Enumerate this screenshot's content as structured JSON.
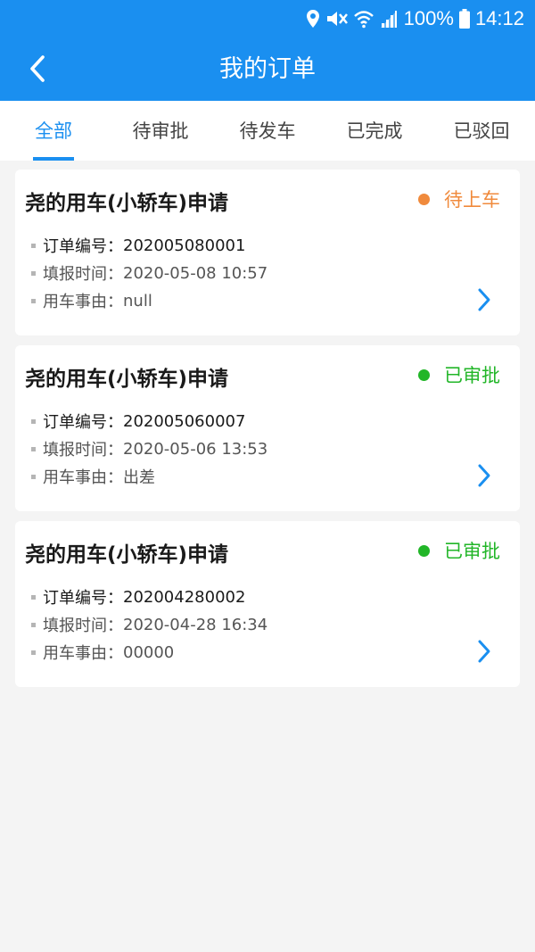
{
  "status_bar": {
    "battery": "100%",
    "time": "14:12"
  },
  "nav": {
    "title": "我的订单",
    "back_icon": "chevron-left-icon"
  },
  "tabs": [
    {
      "label": "全部",
      "active": true
    },
    {
      "label": "待审批",
      "active": false
    },
    {
      "label": "待发车",
      "active": false
    },
    {
      "label": "已完成",
      "active": false
    },
    {
      "label": "已驳回",
      "active": false
    }
  ],
  "colors": {
    "brand": "#1a8ff0",
    "status_waiting": "#f08a3c",
    "status_approved": "#22b628"
  },
  "orders": [
    {
      "title": "尧的用车(小轿车)申请",
      "status": "待上车",
      "status_color": "#f08a3c",
      "order_no_label": "订单编号：",
      "order_no": "202005080001",
      "time_label": "填报时间：",
      "time": "2020-05-08 10:57",
      "reason_label": "用车事由：",
      "reason": "null"
    },
    {
      "title": "尧的用车(小轿车)申请",
      "status": "已审批",
      "status_color": "#22b628",
      "order_no_label": "订单编号：",
      "order_no": "202005060007",
      "time_label": "填报时间：",
      "time": "2020-05-06 13:53",
      "reason_label": "用车事由：",
      "reason": "出差"
    },
    {
      "title": "尧的用车(小轿车)申请",
      "status": "已审批",
      "status_color": "#22b628",
      "order_no_label": "订单编号：",
      "order_no": "202004280002",
      "time_label": "填报时间：",
      "time": "2020-04-28 16:34",
      "reason_label": "用车事由：",
      "reason": "00000"
    }
  ]
}
